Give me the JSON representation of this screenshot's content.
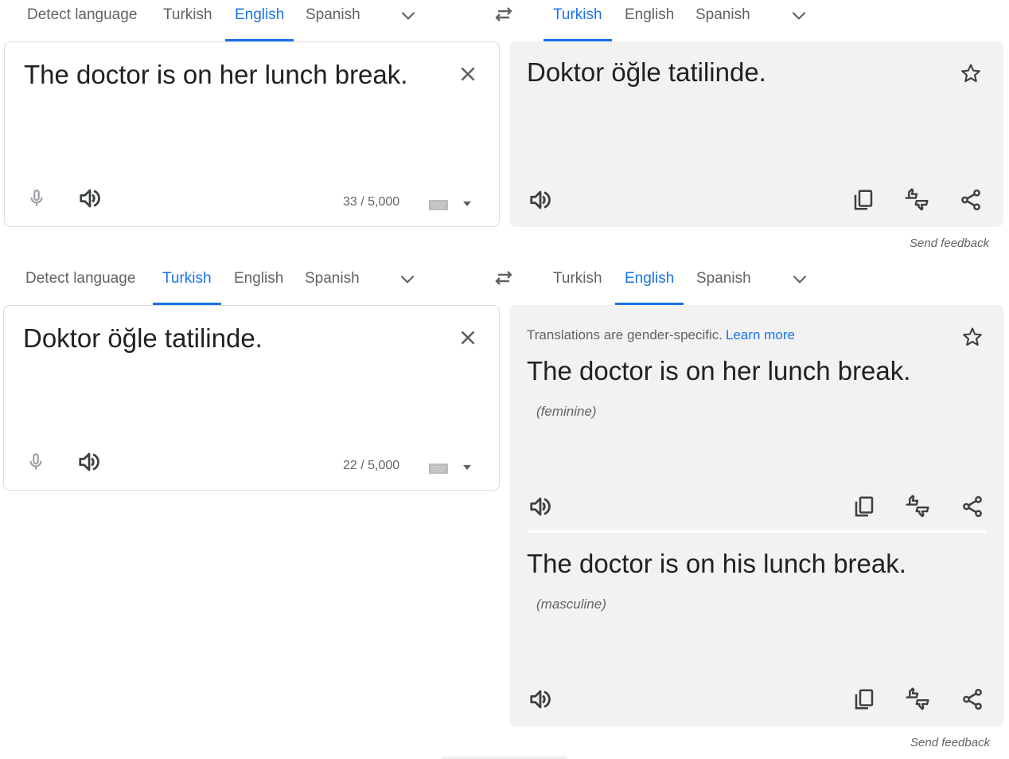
{
  "colors": {
    "accent": "#1a73e8",
    "text": "#202124",
    "muted": "#5f6368",
    "target_bg": "#f2f2f2"
  },
  "panel1": {
    "source_tabs": [
      "Detect language",
      "Turkish",
      "English",
      "Spanish"
    ],
    "source_active": "English",
    "target_tabs": [
      "Turkish",
      "English",
      "Spanish"
    ],
    "target_active": "Turkish",
    "source_text": "The doctor is on her lunch break.",
    "char_count": "33 / 5,000",
    "translation": "Doktor öğle tatilinde.",
    "send_feedback": "Send feedback"
  },
  "panel2": {
    "source_tabs": [
      "Detect language",
      "Turkish",
      "English",
      "Spanish"
    ],
    "source_active": "Turkish",
    "target_tabs": [
      "Turkish",
      "English",
      "Spanish"
    ],
    "target_active": "English",
    "source_text": "Doktor öğle tatilinde.",
    "char_count": "22 / 5,000",
    "gender_note": "Translations are gender-specific.",
    "learn_more": "Learn more",
    "translations": [
      {
        "text": "The doctor is on her lunch break.",
        "gender": "(feminine)"
      },
      {
        "text": "The doctor is on his lunch break.",
        "gender": "(masculine)"
      }
    ],
    "send_feedback": "Send feedback"
  },
  "icons": {
    "close": "close-icon",
    "star": "star-icon",
    "mic": "microphone-icon",
    "speaker": "speaker-icon",
    "copy": "copy-icon",
    "rate": "thumbs-rating-icon",
    "share": "share-icon",
    "keyboard": "keyboard-icon",
    "dropdown": "dropdown-arrow-icon",
    "swap": "swap-languages-icon",
    "chevron": "chevron-down-icon"
  }
}
